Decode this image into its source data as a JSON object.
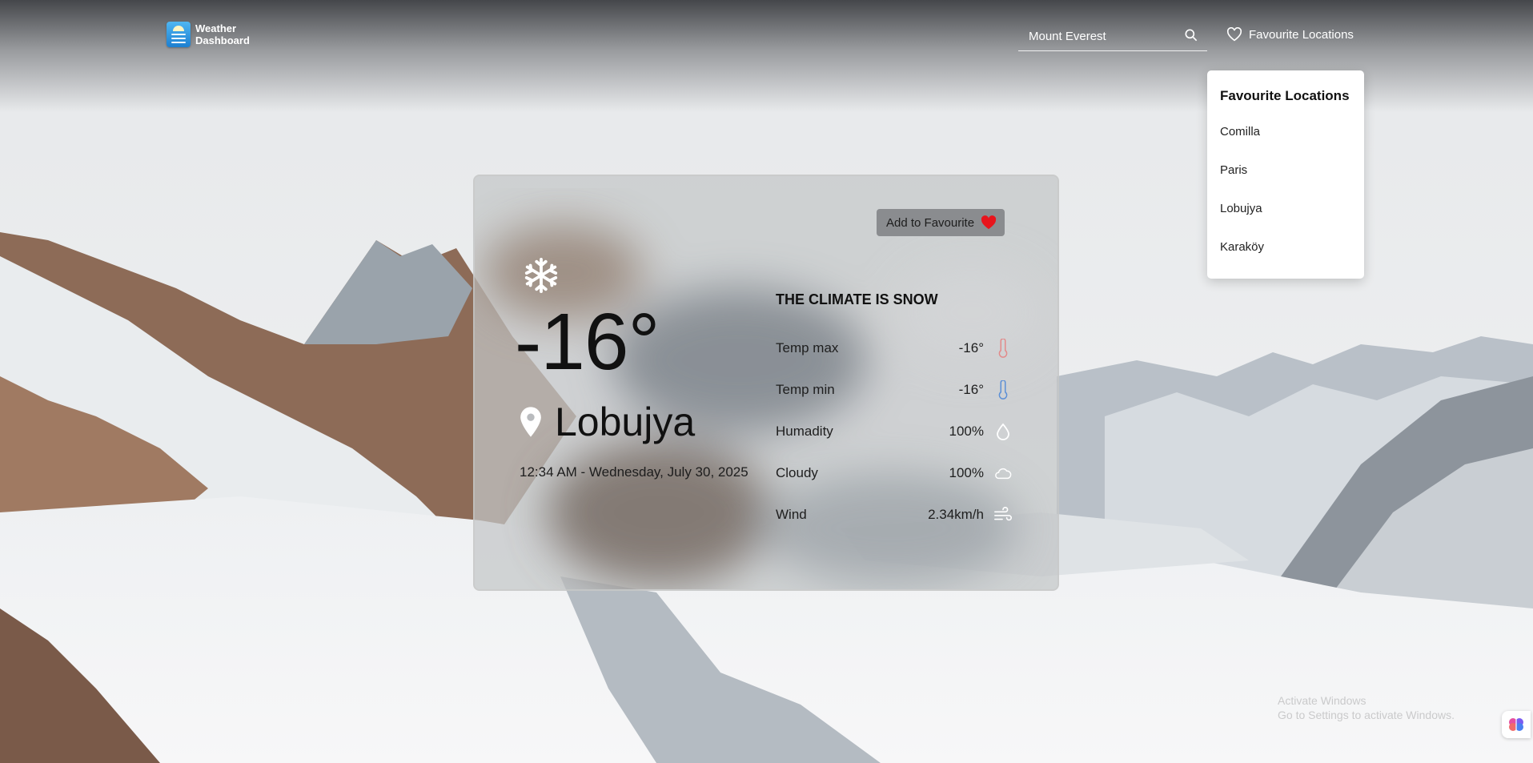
{
  "colors": {
    "accent": "#2b8ce0",
    "heart": "#e8141c",
    "temp_max": "#e38a8a",
    "temp_min": "#5b8fd6"
  },
  "header": {
    "logo_line1": "Weather",
    "logo_line2": "Dashboard",
    "search_value": "Mount Everest",
    "search_icon": "search-icon",
    "favourites_label": "Favourite Locations"
  },
  "dropdown": {
    "title": "Favourite Locations",
    "items": [
      "Comilla",
      "Paris",
      "Lobujya",
      "Karaköy"
    ]
  },
  "card": {
    "add_favourite_label": "Add to Favourite",
    "weather_icon": "snowflake-icon",
    "temperature": "-16°",
    "location": "Lobujya",
    "datetime": "12:34 AM - Wednesday, July 30, 2025",
    "climate": "THE CLIMATE IS SNOW",
    "stats": [
      {
        "label": "Temp max",
        "value": "-16°",
        "icon": "thermometer-hot-icon"
      },
      {
        "label": "Temp min",
        "value": "-16°",
        "icon": "thermometer-cold-icon"
      },
      {
        "label": "Humadity",
        "value": "100%",
        "icon": "droplet-icon"
      },
      {
        "label": "Cloudy",
        "value": "100%",
        "icon": "cloud-icon"
      },
      {
        "label": "Wind",
        "value": "2.34km/h",
        "icon": "wind-icon"
      }
    ]
  },
  "overlay": {
    "activate_line1": "Activate Windows",
    "activate_line2": "Go to Settings to activate Windows."
  }
}
